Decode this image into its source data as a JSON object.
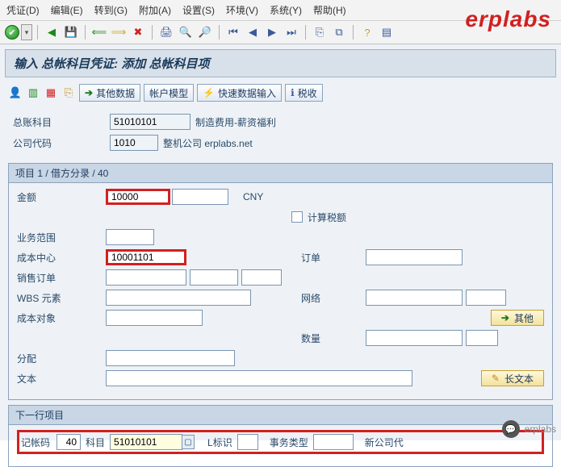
{
  "watermark": "erplabs",
  "menu": {
    "m0": "凭证(D)",
    "m1": "编辑(E)",
    "m2": "转到(G)",
    "m3": "附加(A)",
    "m4": "设置(S)",
    "m5": "环境(V)",
    "m6": "系统(Y)",
    "m7": "帮助(H)"
  },
  "page_title": "输入 总帐科目凭证: 添加 总帐科目项",
  "app_toolbar": {
    "more_data": "其他数据",
    "acct_model": "帐户模型",
    "fast_entry": "快速数据输入",
    "tax": "税收"
  },
  "header": {
    "gl_account_lbl": "总账科目",
    "gl_account": "51010101",
    "gl_account_desc": "制造费用-薪资福利",
    "company_lbl": "公司代码",
    "company": "1010",
    "company_desc": "整机公司 erplabs.net"
  },
  "item_box": {
    "title": "项目 1 / 借方分录 / 40",
    "amount_lbl": "金额",
    "amount": "10000",
    "curr": "CNY",
    "calc_tax_lbl": "计算税额",
    "bus_area_lbl": "业务范围",
    "bus_area": "",
    "cost_center_lbl": "成本中心",
    "cost_center": "10001101",
    "order_lbl": "订单",
    "order": "",
    "sales_order_lbl": "销售订单",
    "sales_order": "",
    "sales_order2": "",
    "sales_order3": "",
    "wbs_lbl": "WBS 元素",
    "wbs": "",
    "network_lbl": "网络",
    "network": "",
    "network2": "",
    "cost_obj_lbl": "成本对象",
    "cost_obj": "",
    "qty_lbl": "数量",
    "qty": "",
    "qty_unit": "",
    "other_btn": "其他",
    "assign_lbl": "分配",
    "assign": "",
    "text_lbl": "文本",
    "text": "",
    "long_text_btn": "长文本"
  },
  "next_box": {
    "title": "下一行项目",
    "pstky_lbl": "记帐码",
    "pstky": "40",
    "account_lbl": "科目",
    "account": "51010101",
    "sgl_lbl": "L标识",
    "sgl": "",
    "ttype_lbl": "事务类型",
    "ttype": "",
    "newco_lbl": "新公司代",
    "newco": ""
  },
  "footer": {
    "name": "erplabs"
  }
}
